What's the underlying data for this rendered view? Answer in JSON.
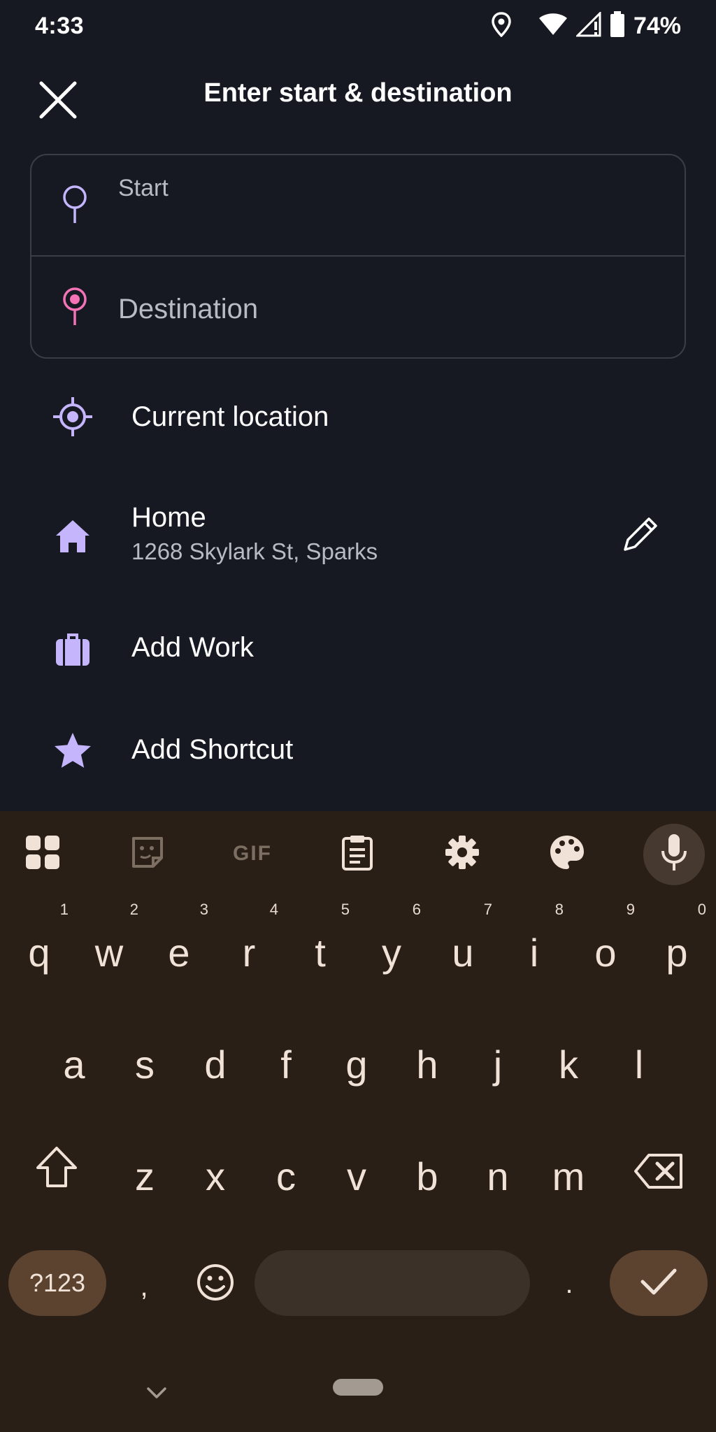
{
  "status_bar": {
    "time": "4:33",
    "battery": "74%",
    "icons": [
      "location-icon",
      "wifi-icon",
      "signal-icon",
      "battery-icon"
    ]
  },
  "app_bar": {
    "title": "Enter start & destination",
    "close_icon": "close-icon"
  },
  "inputs": {
    "start": {
      "label": "Start",
      "value": ""
    },
    "destination": {
      "placeholder": "Destination",
      "value": ""
    }
  },
  "shortcuts": [
    {
      "icon": "crosshair-icon",
      "label": "Current location"
    },
    {
      "icon": "home-icon",
      "label": "Home",
      "address": "1268 Skylark St, Sparks",
      "action_icon": "pencil-icon"
    },
    {
      "icon": "briefcase-icon",
      "label": "Add Work"
    },
    {
      "icon": "star-icon",
      "label": "Add Shortcut"
    }
  ],
  "keyboard": {
    "toolbar": [
      "apps-grid-icon",
      "sticker-icon",
      "gif-icon",
      "clipboard-icon",
      "settings-icon",
      "palette-icon",
      "mic-icon"
    ],
    "gif_label": "GIF",
    "row1": [
      {
        "k": "q",
        "n": "1"
      },
      {
        "k": "w",
        "n": "2"
      },
      {
        "k": "e",
        "n": "3"
      },
      {
        "k": "r",
        "n": "4"
      },
      {
        "k": "t",
        "n": "5"
      },
      {
        "k": "y",
        "n": "6"
      },
      {
        "k": "u",
        "n": "7"
      },
      {
        "k": "i",
        "n": "8"
      },
      {
        "k": "o",
        "n": "9"
      },
      {
        "k": "p",
        "n": "0"
      }
    ],
    "row2": [
      "a",
      "s",
      "d",
      "f",
      "g",
      "h",
      "j",
      "k",
      "l"
    ],
    "row3": [
      "z",
      "x",
      "c",
      "v",
      "b",
      "n",
      "m"
    ],
    "symbols_label": "?123",
    "comma": ",",
    "period": ".",
    "colors": {
      "keyboard_bg": "#2a1f17",
      "accent_pill": "#5c4330",
      "space": "#3b3129",
      "key_text": "#f0e2d6"
    }
  },
  "colors": {
    "background": "#171922",
    "accent_purple": "#c4b5fd",
    "accent_pink": "#f472b6",
    "secondary_text": "#b8bac4"
  }
}
